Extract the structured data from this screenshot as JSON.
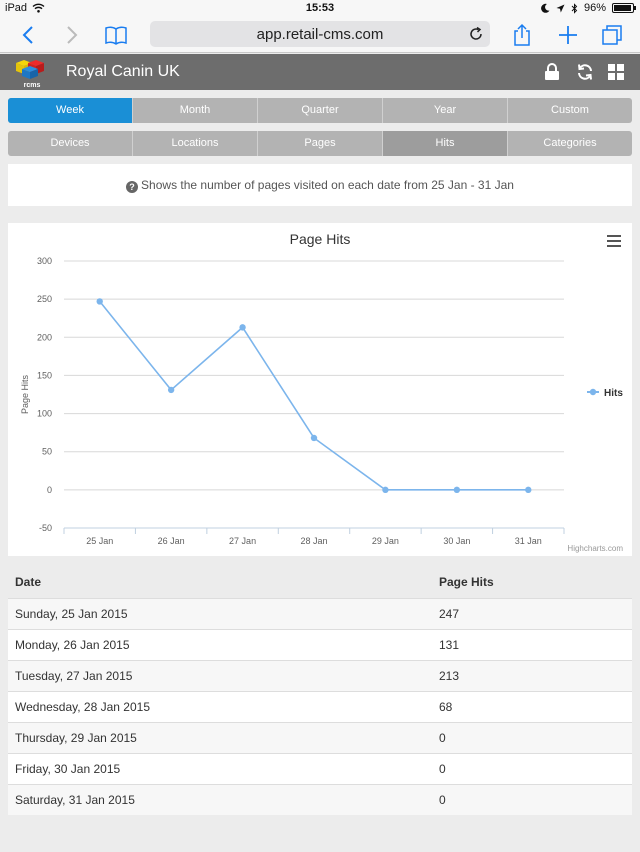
{
  "status_bar": {
    "device": "iPad",
    "time": "15:53",
    "battery": "96%",
    "battery_level": 0.96
  },
  "browser": {
    "url": "app.retail-cms.com"
  },
  "app": {
    "title": "Royal Canin UK",
    "logo_text": "rcms"
  },
  "period_tabs": [
    {
      "label": "Week",
      "active": true
    },
    {
      "label": "Month",
      "active": false
    },
    {
      "label": "Quarter",
      "active": false
    },
    {
      "label": "Year",
      "active": false
    },
    {
      "label": "Custom",
      "active": false
    }
  ],
  "metric_tabs": [
    {
      "label": "Devices",
      "active": false
    },
    {
      "label": "Locations",
      "active": false
    },
    {
      "label": "Pages",
      "active": false
    },
    {
      "label": "Hits",
      "active": true
    },
    {
      "label": "Categories",
      "active": false
    }
  ],
  "info": {
    "text": "Shows the number of pages visited on each date from 25 Jan - 31 Jan"
  },
  "chart_data": {
    "type": "line",
    "title": "Page Hits",
    "ylabel": "Page Hits",
    "xlabel": "",
    "categories": [
      "25 Jan",
      "26 Jan",
      "27 Jan",
      "28 Jan",
      "29 Jan",
      "30 Jan",
      "31 Jan"
    ],
    "series": [
      {
        "name": "Hits",
        "values": [
          247,
          131,
          213,
          68,
          0,
          0,
          0
        ],
        "color": "#7cb5ec"
      }
    ],
    "ylim": [
      -50,
      300
    ],
    "yticks": [
      -50,
      0,
      50,
      100,
      150,
      200,
      250,
      300
    ],
    "grid": true,
    "legend": "right",
    "credits": "Highcharts.com"
  },
  "table": {
    "headers": {
      "date": "Date",
      "hits": "Page Hits"
    },
    "rows": [
      {
        "date": "Sunday, 25 Jan 2015",
        "hits": "247"
      },
      {
        "date": "Monday, 26 Jan 2015",
        "hits": "131"
      },
      {
        "date": "Tuesday, 27 Jan 2015",
        "hits": "213"
      },
      {
        "date": "Wednesday, 28 Jan 2015",
        "hits": "68"
      },
      {
        "date": "Thursday, 29 Jan 2015",
        "hits": "0"
      },
      {
        "date": "Friday, 30 Jan 2015",
        "hits": "0"
      },
      {
        "date": "Saturday, 31 Jan 2015",
        "hits": "0"
      }
    ]
  },
  "colors": {
    "accent": "#1a8fd6",
    "header": "#6d6d6d",
    "series": "#7cb5ec"
  }
}
